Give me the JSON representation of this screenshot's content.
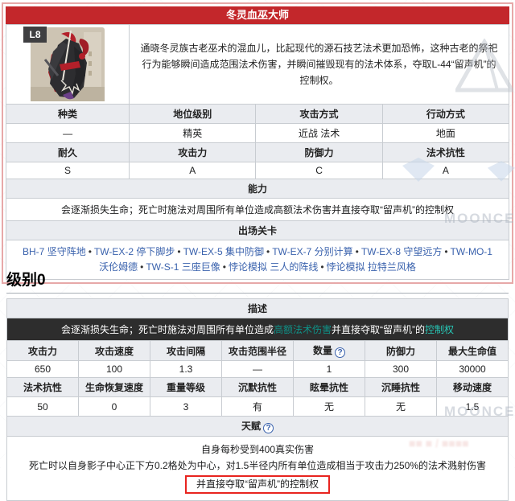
{
  "infobox": {
    "title": "冬灵血巫大师",
    "level_badge": "L8",
    "description": "通晓冬灵族古老巫术的混血儿，比起现代的源石技艺法术更加恐怖，这种古老的祭祀行为能够瞬间造成范围法术伤害，并瞬间摧毁现有的法术体系，夺取L-44“留声机”的控制权。",
    "attr_headers1": [
      "种类",
      "地位级别",
      "攻击方式",
      "行动方式"
    ],
    "attr_values1": [
      "—",
      "精英",
      "近战 法术",
      "地面"
    ],
    "attr_headers2": [
      "耐久",
      "攻击力",
      "防御力",
      "法术抗性"
    ],
    "attr_values2": [
      "S",
      "A",
      "C",
      "A"
    ],
    "ability_header": "能力",
    "ability_text": "会逐渐损失生命；死亡时施法对周围所有单位造成高额法术伤害并直接夺取“留声机”的控制权",
    "stages_header": "出场关卡",
    "stages_sep": "•",
    "stages": [
      "BH-7 坚守阵地",
      "TW-EX-2 停下脚步",
      "TW-EX-5 集中防御",
      "TW-EX-7 分别计算",
      "TW-EX-8 守望远方",
      "TW-MO-1 沃伦姆德",
      "TW-S-1 三座巨像",
      "悖论模拟 三人的阵线",
      "悖论模拟 拉特兰风格"
    ]
  },
  "section_heading": "级别0",
  "level_table": {
    "desc_header": "描述",
    "desc": {
      "pre": "会逐渐损失生命；死亡时施法对周围所有单位造成",
      "highlight1": "高额法术伤害",
      "mid": "并直接夺取“留声机”的",
      "highlight2": "控制权"
    },
    "help_glyph": "?",
    "stat_headers1": [
      "攻击力",
      "攻击速度",
      "攻击间隔",
      "攻击范围半径",
      "数量",
      "防御力",
      "最大生命值"
    ],
    "stat_values1": [
      "650",
      "100",
      "1.3",
      "—",
      "1",
      "300",
      "30000"
    ],
    "stat_headers2": [
      "法术抗性",
      "生命恢复速度",
      "重量等级",
      "沉默抗性",
      "眩晕抗性",
      "沉睡抗性",
      "移动速度"
    ],
    "stat_values2": [
      "50",
      "0",
      "3",
      "有",
      "无",
      "无",
      "1.5"
    ],
    "talent_header": "天赋",
    "talent_lines": [
      "自身每秒受到400真实伤害",
      "死亡时以自身影子中心正下方0.2格处为中心，对1.5半径内所有单位造成相当于攻击力250%的法术溅射伤害",
      "并直接夺取“留声机”的控制权"
    ]
  },
  "watermark": {
    "text": "MOONCELL"
  },
  "colors": {
    "title_red": "#c3272b",
    "annotation_red": "#e8241f",
    "teal_dark": "#0f9187",
    "teal_bright": "#27c7b6",
    "link_blue": "#3a62ad"
  }
}
